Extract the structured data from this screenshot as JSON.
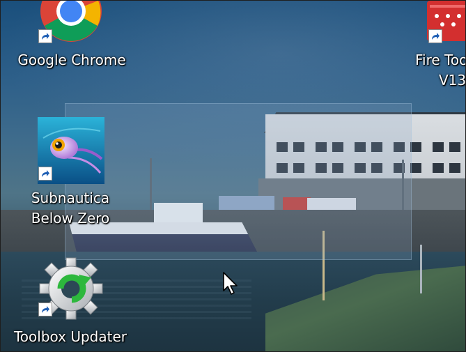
{
  "desktop": {
    "icons": [
      {
        "id": "google-chrome",
        "label": "Google Chrome",
        "icon": "chrome-icon"
      },
      {
        "id": "fire-toolbox",
        "label_lines": [
          "Fire Too",
          "V13"
        ],
        "icon": "fire-toolbox-icon"
      },
      {
        "id": "subnautica",
        "label_lines": [
          "Subnautica",
          "Below Zero"
        ],
        "icon": "subnautica-below-zero-icon"
      },
      {
        "id": "toolbox-updater",
        "label": "Toolbox Updater",
        "icon": "toolbox-updater-gear-icon"
      }
    ],
    "shortcut_overlay_icon": "shortcut-arrow-icon",
    "cursor_icon": "mouse-pointer-icon",
    "selection_active": true
  },
  "colors": {
    "label_text": "#ffffff",
    "selection_fill": "#8caac8",
    "chrome_red": "#db4437",
    "chrome_yellow": "#f4b400",
    "chrome_green": "#0f9d58",
    "chrome_blue": "#4285f4",
    "updater_green": "#2db83d",
    "fire_toolbox_red": "#d32f2f"
  }
}
